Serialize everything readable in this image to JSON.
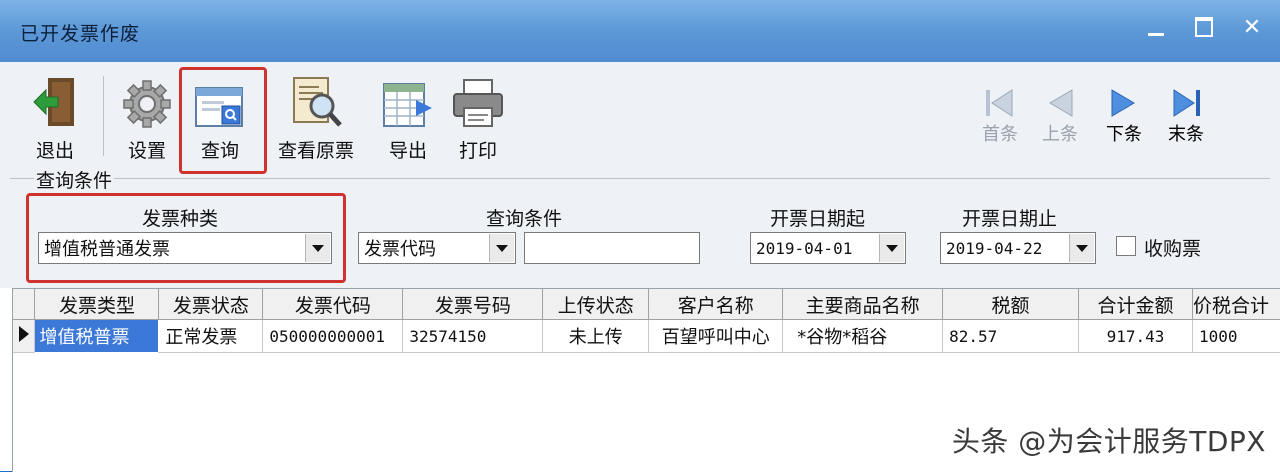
{
  "window": {
    "title": "已开发票作废"
  },
  "toolbar": {
    "exit": "退出",
    "settings": "设置",
    "query": "查询",
    "view_original": "查看原票",
    "export": "导出",
    "print": "打印",
    "first": "首条",
    "prev": "上条",
    "next": "下条",
    "last": "末条"
  },
  "conditions": {
    "group_title": "查询条件",
    "invoice_kind_label": "发票种类",
    "invoice_kind_value": "增值税普通发票",
    "query_cond_label": "查询条件",
    "query_cond_value": "发票代码",
    "query_cond_input": "",
    "date_from_label": "开票日期起",
    "date_from_value": "2019-04-01",
    "date_to_label": "开票日期止",
    "date_to_value": "2019-04-22",
    "purchase_label": "收购票"
  },
  "table": {
    "columns": [
      "发票类型",
      "发票状态",
      "发票代码",
      "发票号码",
      "上传状态",
      "客户名称",
      "主要商品名称",
      "税额",
      "合计金额",
      "价税合计"
    ],
    "rows": [
      [
        "增值税普票",
        "正常发票",
        "050000000001",
        "32574150",
        "未上传",
        "百望呼叫中心",
        "*谷物*稻谷",
        "82.57",
        "917.43",
        "1000"
      ]
    ]
  },
  "watermark": "头条 @为会计服务TDPX",
  "colors": {
    "titlebar": "#5e9ad8",
    "highlight_box": "#d0322f",
    "selected_cell": "#3b78d8"
  }
}
